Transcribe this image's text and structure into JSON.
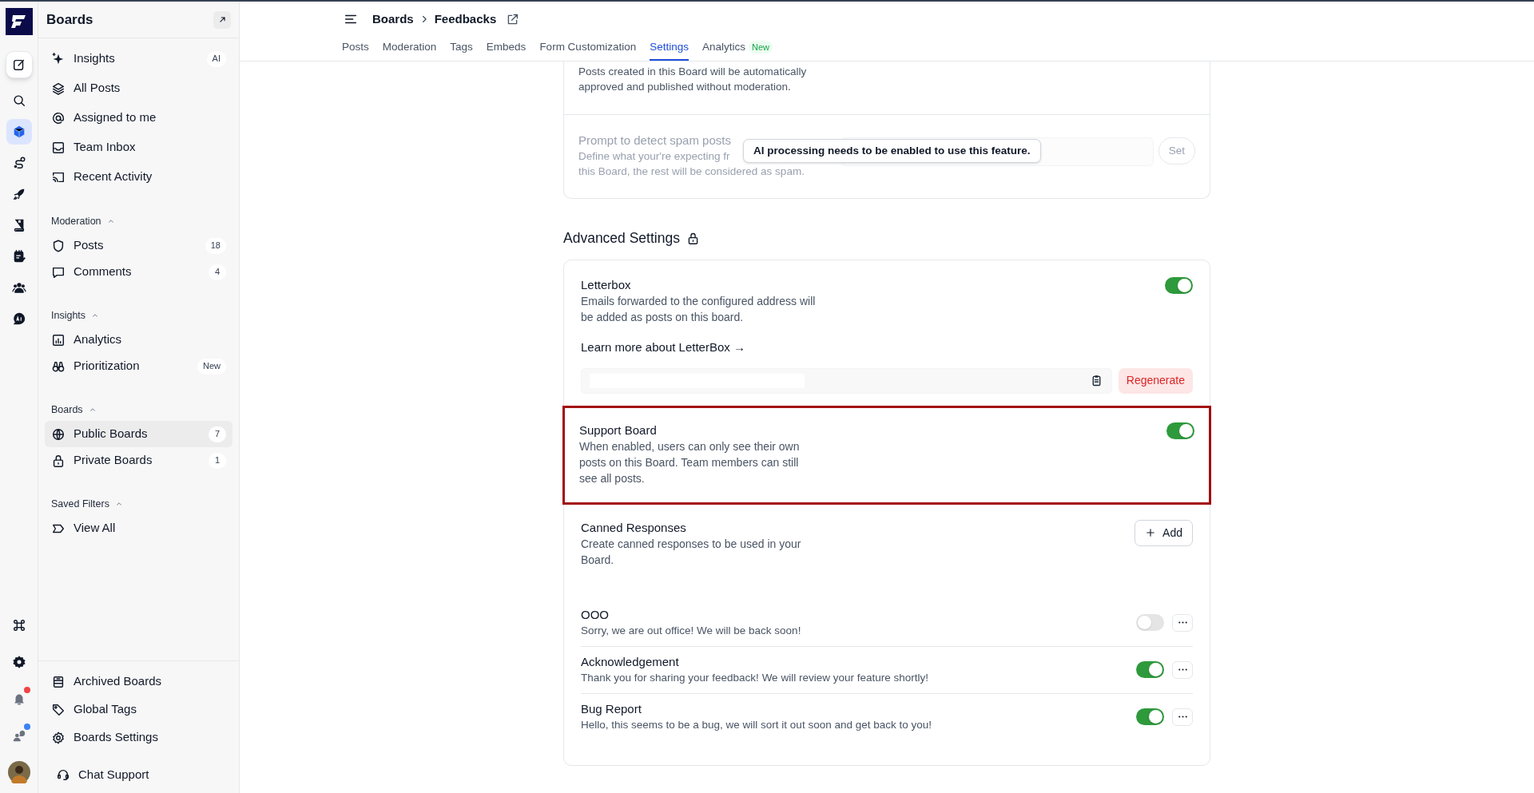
{
  "rail": {
    "top": [
      {
        "kind": "logo"
      },
      {
        "kind": "compose",
        "selected": false
      },
      {
        "kind": "search",
        "selected": false
      },
      {
        "kind": "cube",
        "selected": true
      },
      {
        "kind": "route",
        "selected": false
      },
      {
        "kind": "rocket",
        "selected": false
      },
      {
        "kind": "book",
        "selected": false
      },
      {
        "kind": "notepad",
        "selected": false
      },
      {
        "kind": "users",
        "selected": false
      },
      {
        "kind": "ai-chat",
        "selected": false
      }
    ],
    "bottom": [
      {
        "kind": "command",
        "selected": false
      },
      {
        "kind": "gear",
        "selected": false
      },
      {
        "kind": "bell",
        "selected": false,
        "color": "#ef4444"
      },
      {
        "kind": "chat-person",
        "selected": false,
        "color": "#3b82f6"
      },
      {
        "kind": "avatar"
      }
    ]
  },
  "sidebar": {
    "title": "Boards",
    "nav": [
      {
        "kind": "sparkle",
        "label": "Insights",
        "badge": "AI"
      },
      {
        "kind": "layers",
        "label": "All Posts"
      },
      {
        "kind": "at",
        "label": "Assigned to me"
      },
      {
        "kind": "inbox",
        "label": "Team Inbox"
      },
      {
        "kind": "cast",
        "label": "Recent Activity"
      }
    ],
    "sections": [
      {
        "heading": "Moderation",
        "expanded": true,
        "items": [
          {
            "kind": "shield",
            "label": "Posts",
            "badge": "18",
            "selected": false
          },
          {
            "kind": "comment",
            "label": "Comments",
            "badge": "4",
            "selected": false
          }
        ]
      },
      {
        "heading": "Insights",
        "expanded": true,
        "items": [
          {
            "kind": "chart",
            "label": "Analytics",
            "selected": false
          },
          {
            "kind": "binoculars",
            "label": "Prioritization",
            "badge": "New",
            "selected": false
          }
        ]
      },
      {
        "heading": "Boards",
        "expanded": true,
        "items": [
          {
            "kind": "globe",
            "label": "Public Boards",
            "badge": "7",
            "selected": true
          },
          {
            "kind": "lock",
            "label": "Private Boards",
            "badge": "1",
            "selected": false
          }
        ]
      },
      {
        "heading": "Saved Filters",
        "expanded": true,
        "items": [
          {
            "kind": "label",
            "label": "View All",
            "selected": false
          }
        ]
      }
    ],
    "footer": [
      {
        "kind": "archive",
        "label": "Archived Boards"
      },
      {
        "kind": "tag",
        "label": "Global Tags"
      },
      {
        "kind": "gear",
        "label": "Boards Settings"
      }
    ],
    "chat_support": "Chat Support"
  },
  "breadcrumbs": [
    "Boards",
    "Feedbacks"
  ],
  "tabs": [
    {
      "label": "Posts",
      "selected": false
    },
    {
      "label": "Moderation",
      "selected": false
    },
    {
      "label": "Tags",
      "selected": false
    },
    {
      "label": "Embeds",
      "selected": false
    },
    {
      "label": "Form Customization",
      "selected": false
    },
    {
      "label": "Settings",
      "selected": true
    },
    {
      "label": "Analytics",
      "selected": false,
      "badge": "New"
    }
  ],
  "general_card": {
    "auto_approve": {
      "description": "Posts created in this Board will be automatically approved and published without moderation."
    },
    "spam_prompt": {
      "title": "Prompt to detect spam posts",
      "description_lines": [
        "Define what your're expecting fr",
        "this Board, the rest will be considered as spam."
      ],
      "disabled": true,
      "button": "Set",
      "tooltip": "AI processing needs to be enabled to use this feature."
    }
  },
  "advanced": {
    "title": "Advanced Settings",
    "settings": [
      {
        "kind": "letterbox",
        "title": "Letterbox",
        "description": "Emails forwarded to the configured address will be added as posts on this board.",
        "on": true,
        "highlighted": false,
        "link": "Learn more about LetterBox →",
        "button": "Regenerate"
      },
      {
        "kind": "toggle",
        "title": "Support Board",
        "description": "When enabled, users can only see their own posts on this Board. Team members can still see all posts.",
        "on": true,
        "highlighted": true
      },
      {
        "kind": "canned",
        "title": "Canned Responses",
        "description": "Create canned responses to be used in your Board.",
        "highlighted": false,
        "button": "Add",
        "responses": [
          {
            "title": "OOO",
            "text": "Sorry, we are out office! We will be back soon!",
            "on": false
          },
          {
            "title": "Acknowledgement",
            "text": "Thank you for sharing your feedback! We will review your feature shortly!",
            "on": true
          },
          {
            "title": "Bug Report",
            "text": "Hello, this seems to be a bug, we will sort it out soon and get back to you!",
            "on": true
          }
        ]
      }
    ]
  }
}
